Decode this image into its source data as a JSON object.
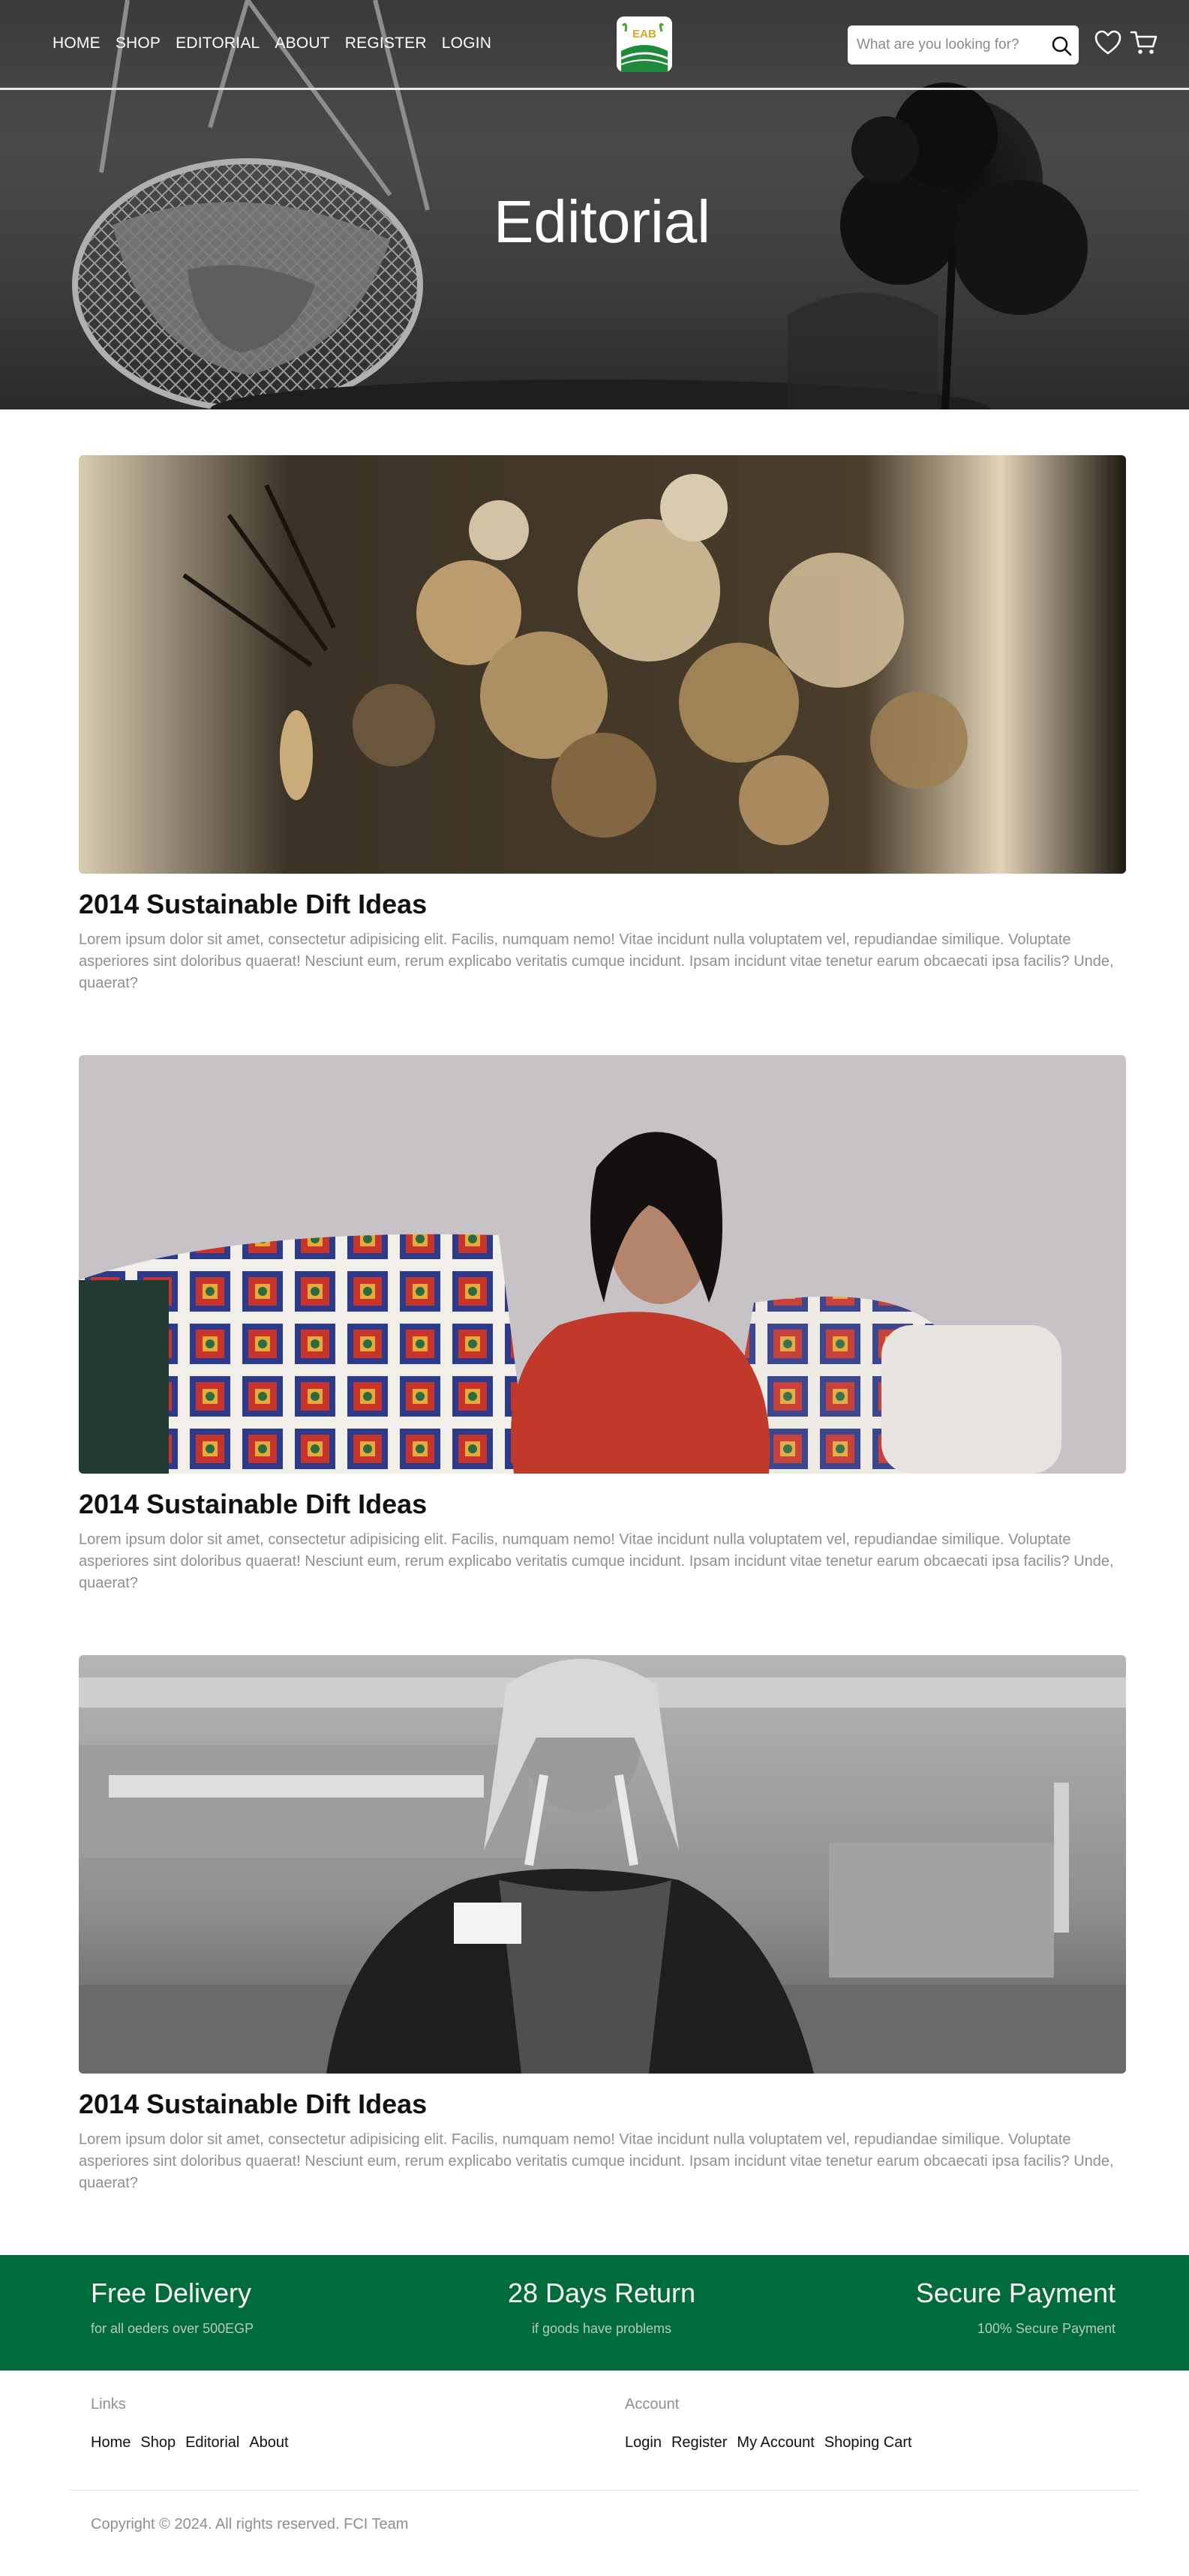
{
  "header": {
    "nav": [
      "HOME",
      "SHOP",
      "EDITORIAL",
      "ABOUT",
      "REGISTER",
      "LOGIN"
    ],
    "logo_text": "EAB",
    "search_placeholder": "What are you looking for?",
    "icons": [
      "search-icon",
      "heart-icon",
      "cart-icon"
    ]
  },
  "hero": {
    "title": "Editorial"
  },
  "articles": [
    {
      "title": "2014 Sustainable Dift Ideas",
      "body": "Lorem ipsum dolor sit amet, consectetur adipisicing elit. Facilis, numquam nemo! Vitae incidunt nulla voluptatem vel, repudiandae similique. Voluptate asperiores sint doloribus quaerat! Nesciunt eum, rerum explicabo veritatis cumque incidunt. Ipsam incidunt vitae tenetur earum obcaecati ipsa facilis? Unde, quaerat?"
    },
    {
      "title": "2014 Sustainable Dift Ideas",
      "body": "Lorem ipsum dolor sit amet, consectetur adipisicing elit. Facilis, numquam nemo! Vitae incidunt nulla voluptatem vel, repudiandae similique. Voluptate asperiores sint doloribus quaerat! Nesciunt eum, rerum explicabo veritatis cumque incidunt. Ipsam incidunt vitae tenetur earum obcaecati ipsa facilis? Unde, quaerat?"
    },
    {
      "title": "2014 Sustainable Dift Ideas",
      "body": "Lorem ipsum dolor sit amet, consectetur adipisicing elit. Facilis, numquam nemo! Vitae incidunt nulla voluptatem vel, repudiandae similique. Voluptate asperiores sint doloribus quaerat! Nesciunt eum, rerum explicabo veritatis cumque incidunt. Ipsam incidunt vitae tenetur earum obcaecati ipsa facilis? Unde, quaerat?"
    }
  ],
  "features": [
    {
      "title": "Free Delivery",
      "subtitle": "for all oeders over 500EGP"
    },
    {
      "title": "28 Days Return",
      "subtitle": "if goods have problems"
    },
    {
      "title": "Secure Payment",
      "subtitle": "100% Secure Payment"
    }
  ],
  "footer": {
    "links_title": "Links",
    "links": [
      "Home",
      "Shop",
      "Editorial",
      "About"
    ],
    "account_title": "Account",
    "account_links": [
      "Login",
      "Register",
      "My Account",
      "Shoping Cart"
    ],
    "copyright": "Copyright © 2024. All rights reserved. FCI Team"
  },
  "colors": {
    "brand_green": "#006b3b",
    "muted_text": "#8f8f8f",
    "white": "#ffffff"
  }
}
